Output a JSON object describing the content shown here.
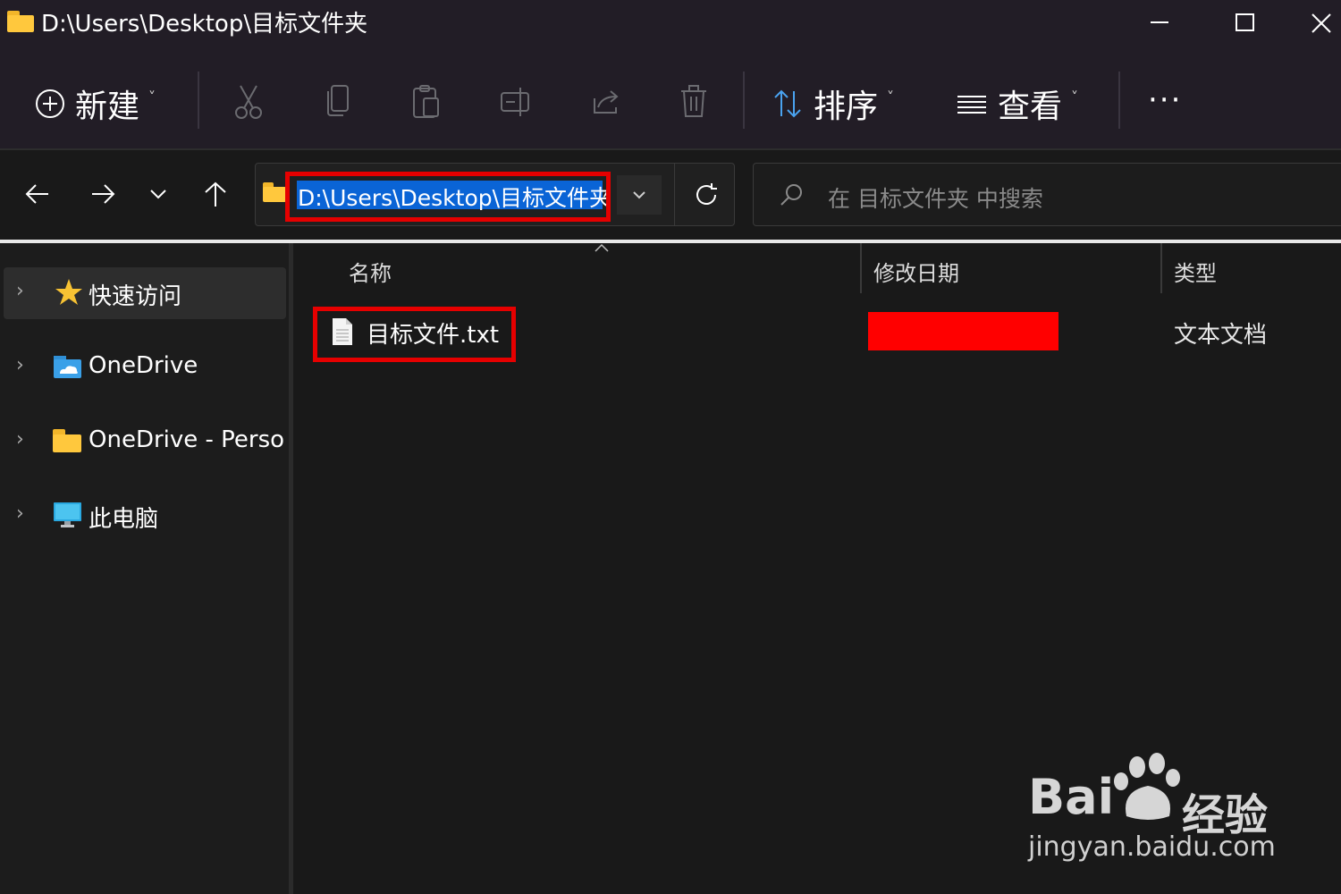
{
  "window": {
    "title": "D:\\Users\\Desktop\\目标文件夹"
  },
  "command_bar": {
    "new_label": "新建",
    "sort_label": "排序",
    "view_label": "查看",
    "more_label": "···",
    "icons": [
      "plus-circle-icon",
      "cut-icon",
      "copy-icon",
      "paste-icon",
      "rename-icon",
      "share-icon",
      "delete-icon",
      "sort-icon",
      "view-lines-icon"
    ]
  },
  "address_bar": {
    "path": "D:\\Users\\Desktop\\目标文件夹"
  },
  "search": {
    "placeholder": "在 目标文件夹 中搜索"
  },
  "sidebar": {
    "items": [
      {
        "label": "快速访问",
        "icon": "star-icon",
        "selected": true
      },
      {
        "label": "OneDrive",
        "icon": "onedrive-folder-icon"
      },
      {
        "label": "OneDrive - Persona",
        "icon": "folder-icon"
      },
      {
        "label": "此电脑",
        "icon": "monitor-icon"
      }
    ]
  },
  "file_list": {
    "columns": [
      "名称",
      "修改日期",
      "类型"
    ],
    "rows": [
      {
        "name": "目标文件.txt",
        "modified": "",
        "type": "文本文档"
      }
    ]
  },
  "watermark": {
    "brand_latin": "Bai",
    "brand_cn": "经验",
    "url": "jingyan.baidu.com"
  },
  "colors": {
    "highlight_box": "#e60000",
    "selection_blue": "#0a64d6",
    "folder_yellow": "#ffc83d",
    "background": "#191919"
  }
}
